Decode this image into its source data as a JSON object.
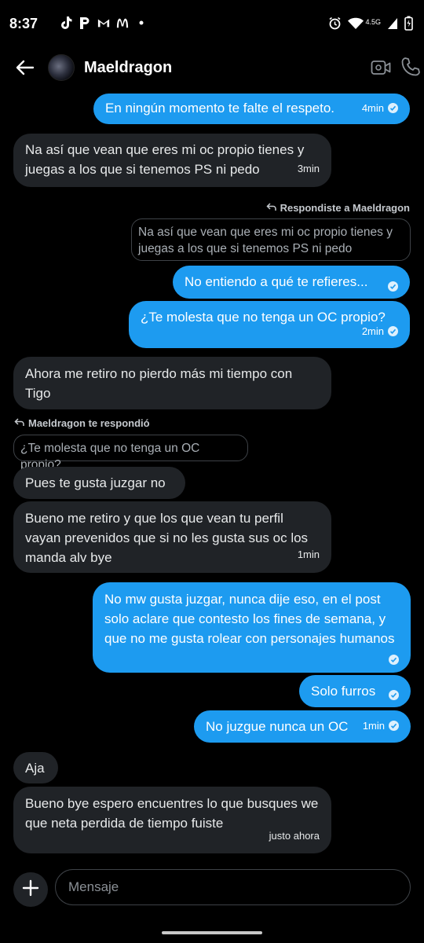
{
  "status_bar": {
    "time": "8:37",
    "network": "4.5G",
    "left_icons": [
      "tiktok-icon",
      "p-app-icon",
      "gmail-icon",
      "mcdonalds-icon",
      "dot-icon"
    ],
    "right_icons": [
      "alarm-icon",
      "wifi-icon",
      "signal-icon",
      "battery-icon"
    ]
  },
  "header": {
    "contact_name": "Maeldragon"
  },
  "messages": [
    {
      "dir": "out",
      "text": "En ningún momento te falte el respeto.",
      "time": "4min",
      "read": true
    },
    {
      "dir": "in",
      "text": "Na así que vean que eres mi oc propio tienes y juegas a los que si tenemos PS ni pedo",
      "time": "3min"
    },
    {
      "dir": "out-reply-label",
      "text": "Respondiste a Maeldragon"
    },
    {
      "dir": "out-quote",
      "text": "Na así que vean que eres mi oc propio tienes y juegas a los que si tenemos PS ni pedo"
    },
    {
      "dir": "out",
      "text": "No entiendo a qué te refieres...",
      "read": true
    },
    {
      "dir": "out",
      "text": "¿Te molesta que no tenga un OC propio?",
      "time": "2min",
      "read": true
    },
    {
      "dir": "in",
      "text": "Ahora me retiro no pierdo más mi tiempo con Tigo"
    },
    {
      "dir": "in-reply-label",
      "text": "Maeldragon te respondió"
    },
    {
      "dir": "in-quote",
      "text": "¿Te molesta que no tenga un OC propio?"
    },
    {
      "dir": "in",
      "text": "Pues te gusta juzgar no"
    },
    {
      "dir": "in",
      "text": "Bueno me retiro y que los que vean tu perfil vayan prevenidos que si no les gusta sus oc los manda alv bye",
      "time": "1min"
    },
    {
      "dir": "out",
      "text": "No mw gusta juzgar, nunca dije eso, en el post solo aclare que contesto los fines de semana, y que no me gusta rolear con personajes humanos",
      "read": true
    },
    {
      "dir": "out",
      "text": "Solo furros",
      "read": true
    },
    {
      "dir": "out",
      "text": "No juzgue nunca un OC",
      "time": "1min",
      "read": true
    },
    {
      "dir": "in",
      "text": "Aja"
    },
    {
      "dir": "in",
      "text": "Bueno bye espero encuentres lo que busques we que neta perdida de tiempo fuiste",
      "time": "justo ahora"
    }
  ],
  "composer": {
    "placeholder": "Mensaje"
  },
  "colors": {
    "outgoing_bubble": "#1d9bf0",
    "incoming_bubble": "#202327",
    "background": "#000000"
  }
}
